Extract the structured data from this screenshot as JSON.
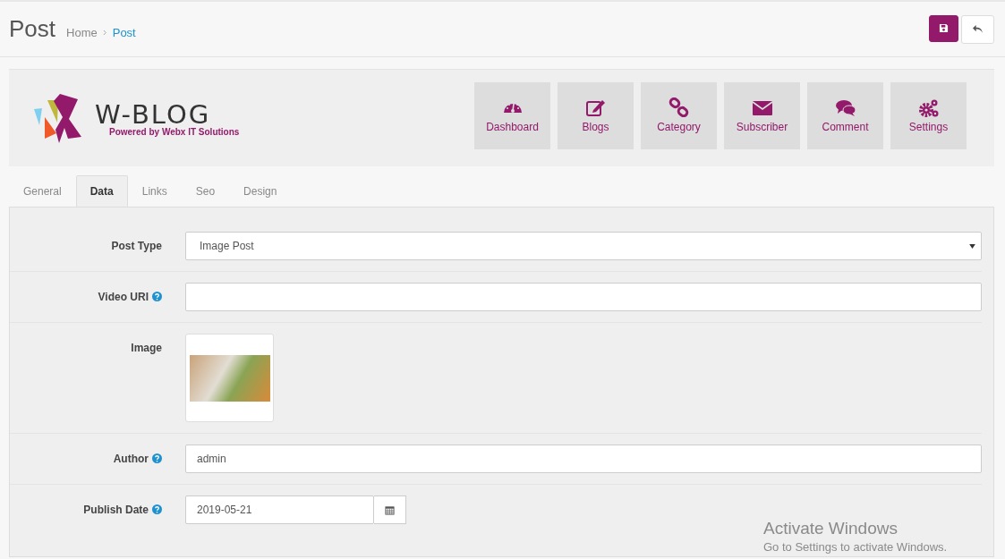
{
  "page": {
    "title": "Post",
    "breadcrumb": [
      {
        "label": "Home",
        "selected": false
      },
      {
        "label": "Post",
        "selected": true
      }
    ]
  },
  "header_buttons": [
    {
      "kind": "save"
    },
    {
      "kind": "back"
    }
  ],
  "logo": {
    "name": "W-BLOG",
    "tagline": "Powered by Webx IT Solutions"
  },
  "nav_tiles": [
    {
      "label": "Dashboard",
      "kind": "gauge"
    },
    {
      "label": "Blogs",
      "kind": "edit"
    },
    {
      "label": "Category",
      "kind": "link"
    },
    {
      "label": "Subscriber",
      "kind": "envelope"
    },
    {
      "label": "Comment",
      "kind": "comments"
    },
    {
      "label": "Settings",
      "kind": "gears"
    }
  ],
  "tabs": [
    {
      "label": "General",
      "selected": false
    },
    {
      "label": "Data",
      "selected": true
    },
    {
      "label": "Links",
      "selected": false
    },
    {
      "label": "Seo",
      "selected": false
    },
    {
      "label": "Design",
      "selected": false
    }
  ],
  "fields": [
    {
      "kind": "select",
      "label": "Post Type",
      "help": false,
      "value": "Image Post"
    },
    {
      "kind": "text",
      "label": "Video URI",
      "help": true
    },
    {
      "kind": "image",
      "label": "Image",
      "help": false
    },
    {
      "kind": "text",
      "label": "Author",
      "help": true,
      "value": "admin"
    },
    {
      "kind": "date",
      "label": "Publish Date",
      "help": true,
      "value": "2019-05-21"
    }
  ],
  "os_notice": {
    "title": "Activate Windows",
    "text": "Go to Settings to activate Windows."
  }
}
